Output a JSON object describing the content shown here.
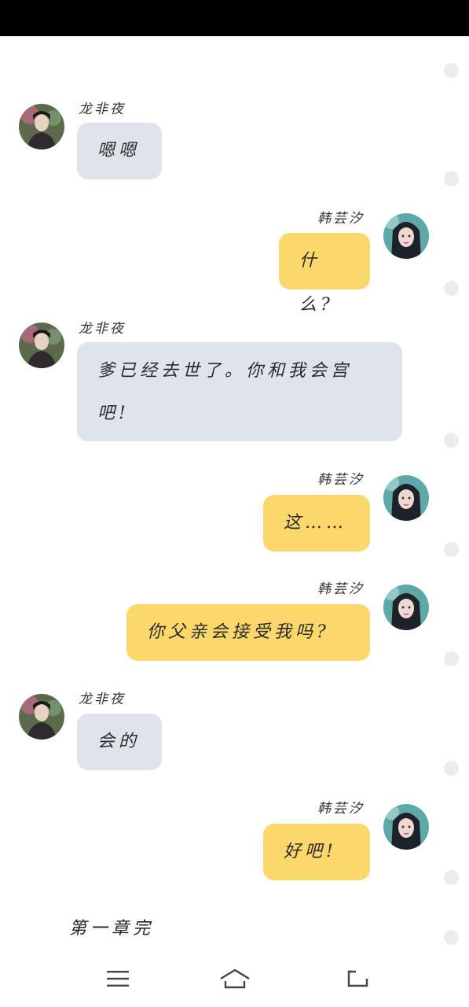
{
  "messages": [
    {
      "side": "left",
      "sender": "龙非夜",
      "text": "嗯嗯",
      "avatar_icon": "male-avatar-icon"
    },
    {
      "side": "right",
      "sender": "韩芸汐",
      "text": "什么?",
      "avatar_icon": "female-avatar-icon"
    },
    {
      "side": "left",
      "sender": "龙非夜",
      "text": "爹已经去世了。你和我会宫吧!",
      "avatar_icon": "male-avatar-icon"
    },
    {
      "side": "right",
      "sender": "韩芸汐",
      "text": "这……",
      "avatar_icon": "female-avatar-icon"
    },
    {
      "side": "right",
      "sender": "韩芸汐",
      "text": "你父亲会接受我吗?",
      "avatar_icon": "female-avatar-icon"
    },
    {
      "side": "left",
      "sender": "龙非夜",
      "text": "会的",
      "avatar_icon": "male-avatar-icon"
    },
    {
      "side": "right",
      "sender": "韩芸汐",
      "text": "好吧!",
      "avatar_icon": "female-avatar-icon"
    }
  ],
  "chapter_end_text": "第一章完",
  "nav": {
    "menu_icon": "menu-icon",
    "home_icon": "home-icon",
    "back_icon": "back-icon"
  },
  "colors": {
    "left_bubble": "#dfe4ec",
    "right_bubble": "#fcd86c",
    "status_bar": "#000000"
  }
}
